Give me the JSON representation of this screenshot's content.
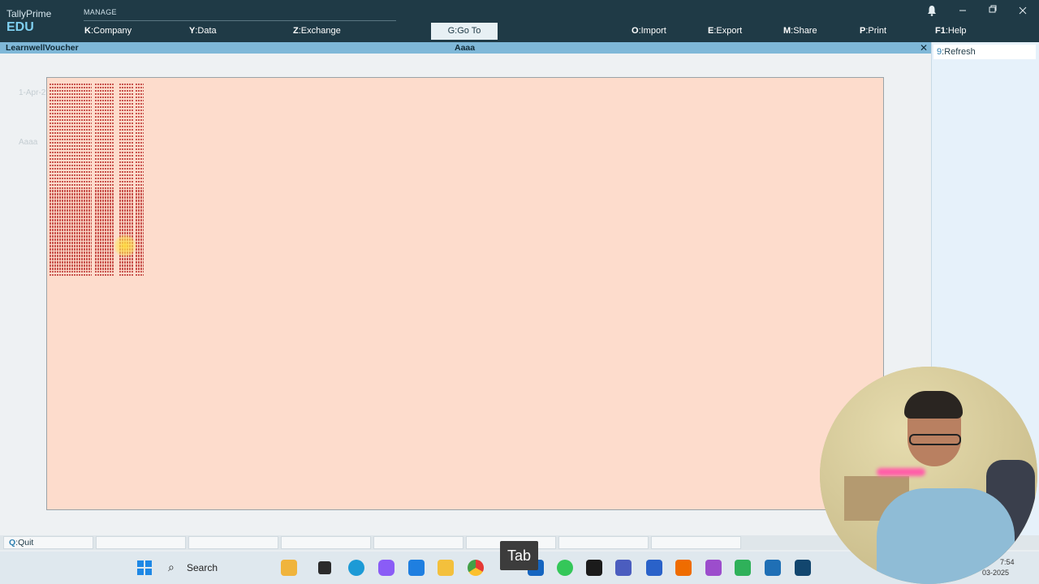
{
  "app": {
    "product": "TallyPrime",
    "edition": "EDU"
  },
  "menu": {
    "section": "MANAGE",
    "items": [
      {
        "key": "K",
        "label": "Company"
      },
      {
        "key": "Y",
        "label": "Data"
      },
      {
        "key": "Z",
        "label": "Exchange"
      },
      {
        "key": "G",
        "label": "Go To"
      },
      {
        "key": "O",
        "label": "Import"
      },
      {
        "key": "E",
        "label": "Export"
      },
      {
        "key": "M",
        "label": "Share"
      },
      {
        "key": "P",
        "label": "Print"
      },
      {
        "key": "F1",
        "label": "Help"
      }
    ]
  },
  "titlebar": {
    "left": "LearnwellVoucher",
    "center": "Aaaa",
    "close_glyph": "✕"
  },
  "ghost": {
    "date": "1-Apr-2",
    "party": "Aaaa"
  },
  "right_panel": {
    "refresh_key": "9",
    "refresh_label": "Refresh"
  },
  "bottom_bar": {
    "quit_key": "Q",
    "quit_label": "Quit"
  },
  "taskbar": {
    "search_label": "Search",
    "icons": [
      "windows-start-icon",
      "search-icon",
      "video-editor-icon",
      "files-icon",
      "edge-icon",
      "copilot-icon",
      "mail-icon",
      "folder-icon",
      "chrome-icon",
      "chrome-profile-icon",
      "outlook-icon",
      "whatsapp-icon",
      "acrobat-icon",
      "teams-icon",
      "word-icon",
      "mic-app-icon",
      "clapper-icon",
      "calculator-icon",
      "tally-icon",
      "blue-app-icon"
    ]
  },
  "overlay": {
    "key_pressed": "Tab"
  },
  "tray": {
    "time": "7:54",
    "date": "03-2025"
  },
  "colors": {
    "topbar": "#1f3a46",
    "accent": "#7fd0f0",
    "paper": "#fddccc",
    "ink": "#c9544e"
  }
}
